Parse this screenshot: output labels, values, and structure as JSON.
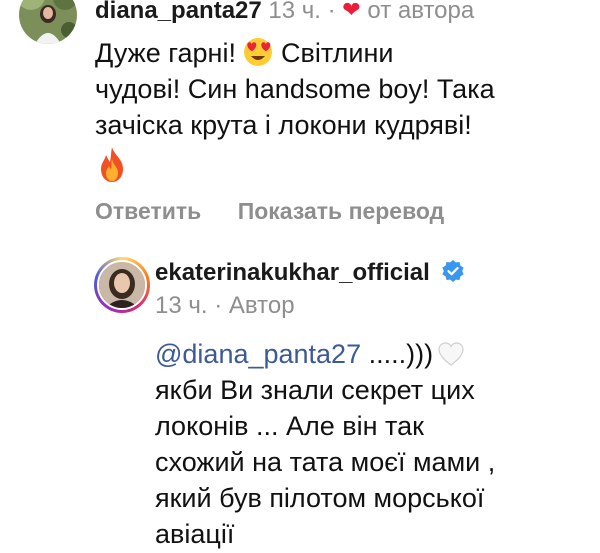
{
  "comment1": {
    "username": "diana_panta27",
    "time": "13 ч.",
    "separator": "·",
    "liked_by_author_label": "от автора",
    "lines": [
      "Дуже гарні!",
      "Світлини",
      "чудові! Син handsome boy! Така",
      "зачіска крута і локони кудряві!"
    ],
    "emoji_heart_eyes": "heart-eyes-emoji-icon",
    "emoji_fire": "fire-icon",
    "actions": {
      "reply_label": "Ответить",
      "translate_label": "Показать перевод"
    }
  },
  "reply": {
    "username": "ekaterinakukhar_official",
    "verified_icon": "verified-badge-icon",
    "time": "13 ч.",
    "separator": "·",
    "author_label": "Автор",
    "mention": "@diana_panta27",
    "first_line_rest": " .....)))",
    "lines": [
      "якби Ви знали секрет цих",
      "локонів ... Але він так",
      "схожий на тата моєї мами ,",
      "який був пілотом морської",
      "авіації"
    ]
  },
  "colors": {
    "meta_gray": "#8e8e8e",
    "mention_blue": "#3c5a96",
    "heart_red": "#ed1c3a",
    "verified_blue": "#3897f0"
  }
}
